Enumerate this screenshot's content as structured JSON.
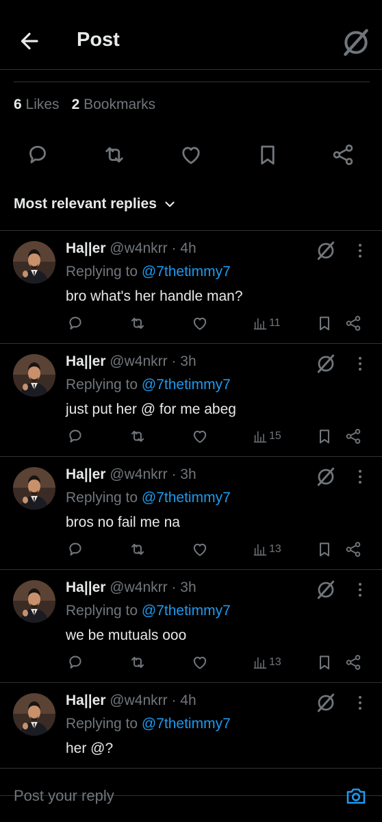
{
  "header": {
    "title": "Post",
    "back_icon": "arrow-left-icon",
    "grok_icon": "grok-icon"
  },
  "stats": {
    "likes_count": "6",
    "likes_label": "Likes",
    "bookmarks_count": "2",
    "bookmarks_label": "Bookmarks"
  },
  "actions": [
    "reply-icon",
    "repost-icon",
    "like-icon",
    "bookmark-icon",
    "share-icon"
  ],
  "sort": {
    "label": "Most relevant replies"
  },
  "replies": [
    {
      "name": "Ha||er",
      "handle": "@w4nkrr",
      "time": "· 4h",
      "replying_prefix": "Replying to",
      "replying_to": "@7thetimmy7",
      "text": "bro what's her handle man?",
      "views": "11"
    },
    {
      "name": "Ha||er",
      "handle": "@w4nkrr",
      "time": "· 3h",
      "replying_prefix": "Replying to",
      "replying_to": "@7thetimmy7",
      "text": "just put her @ for me abeg",
      "views": "15"
    },
    {
      "name": "Ha||er",
      "handle": "@w4nkrr",
      "time": "· 3h",
      "replying_prefix": "Replying to",
      "replying_to": "@7thetimmy7",
      "text": "bros no fail me na",
      "views": "13"
    },
    {
      "name": "Ha||er",
      "handle": "@w4nkrr",
      "time": "· 3h",
      "replying_prefix": "Replying to",
      "replying_to": "@7thetimmy7",
      "text": "we be mutuals ooo",
      "views": "13"
    },
    {
      "name": "Ha||er",
      "handle": "@w4nkrr",
      "time": "· 4h",
      "replying_prefix": "Replying to",
      "replying_to": "@7thetimmy7",
      "text": "her @?",
      "views": ""
    }
  ],
  "compose": {
    "placeholder": "Post your reply"
  },
  "colors": {
    "background": "#000000",
    "text": "#e7e9ea",
    "muted": "#71767b",
    "link": "#1d9bf0",
    "divider": "#2f3336"
  }
}
